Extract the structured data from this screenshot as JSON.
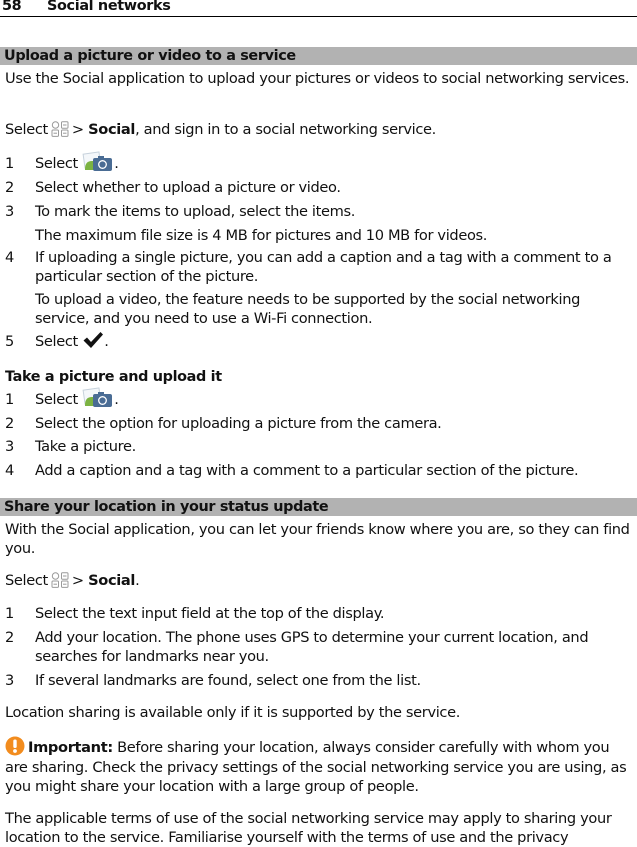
{
  "running_head": {
    "page_number": "58",
    "chapter": "Social networks"
  },
  "sections": [
    {
      "heading": "Upload a picture or video to a service",
      "intro": "Use the Social application to upload your pictures or videos to social networking services.",
      "select_line": {
        "prefix": "Select",
        "sep": ">",
        "target": "Social",
        "suffix": ", and sign in to a social networking service."
      },
      "steps": [
        {
          "num": "1",
          "prefix": "Select",
          "suffix": "."
        },
        {
          "num": "2",
          "text": "Select whether to upload a picture or video."
        },
        {
          "num": "3",
          "text": "To mark the items to upload, select the items.",
          "note": "The maximum file size is 4 MB for pictures and 10 MB for videos."
        },
        {
          "num": "4",
          "text": "If uploading a single picture, you can add a caption and a tag with a comment to a particular section of the picture.",
          "note": "To upload a video, the feature needs to be supported by the social networking service, and you need to use a Wi-Fi connection."
        },
        {
          "num": "5",
          "prefix": "Select",
          "suffix": "."
        }
      ]
    },
    {
      "heading": "Take a picture and upload it",
      "steps": [
        {
          "num": "1",
          "prefix": "Select",
          "suffix": "."
        },
        {
          "num": "2",
          "text": "Select the option for uploading a picture from the camera."
        },
        {
          "num": "3",
          "text": "Take a picture."
        },
        {
          "num": "4",
          "text": "Add a caption and a tag with a comment to a particular section of the picture."
        }
      ]
    },
    {
      "heading": "Share your location in your status update",
      "intro": "With the Social application, you can let your friends know where you are, so they can find you.",
      "select_line": {
        "prefix": "Select",
        "sep": ">",
        "target": "Social",
        "suffix": "."
      },
      "steps": [
        {
          "num": "1",
          "text": "Select the text input field at the top of the display."
        },
        {
          "num": "2",
          "text": "Add your location. The phone uses GPS to determine your current location, and searches for landmarks near you."
        },
        {
          "num": "3",
          "text": "If several landmarks are found, select one from the list."
        }
      ],
      "availability": "Location sharing is available only if it is supported by the service.",
      "important": {
        "label": "Important:",
        "text": "Before sharing your location, always consider carefully with whom you are sharing. Check the privacy settings of the social networking service you are using, as you might share your location with a large group of people."
      },
      "terms": "The applicable terms of use of the social networking service may apply to sharing your location to the service. Familiarise yourself with the terms of use and the privacy"
    }
  ],
  "icons": {
    "menu": "app-menu-grid-icon",
    "camera": "camera-upload-icon",
    "done": "checkmark-icon",
    "warning": "warning-exclamation-icon"
  },
  "colors": {
    "section_bar": "#b2b2b2",
    "warning": "#f28c1e",
    "camera_blue": "#4a6c94",
    "camera_green": "#7cb342"
  }
}
